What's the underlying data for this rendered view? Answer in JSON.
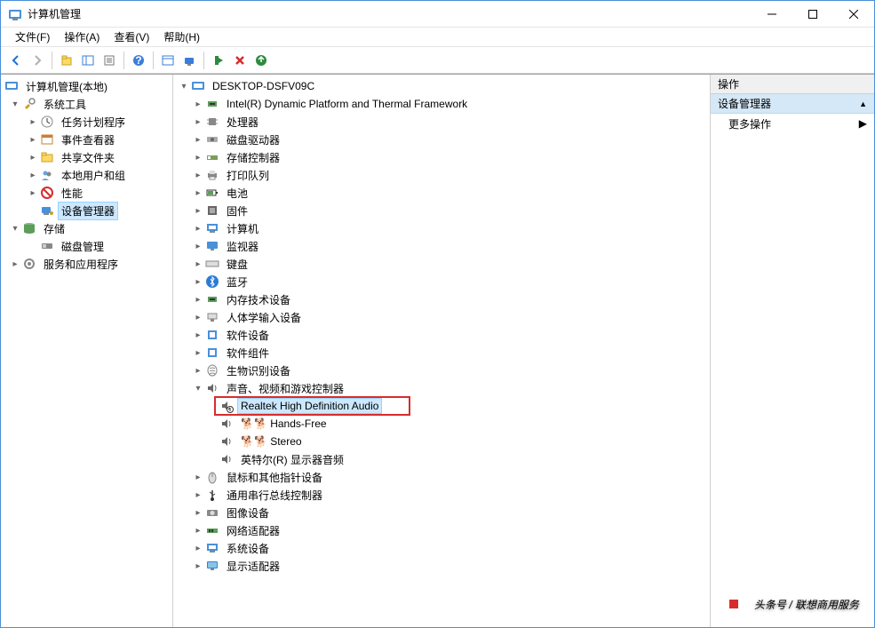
{
  "window": {
    "title": "计算机管理"
  },
  "menu": {
    "file": "文件(F)",
    "action": "操作(A)",
    "view": "查看(V)",
    "help": "帮助(H)"
  },
  "left_tree": {
    "root": "计算机管理(本地)",
    "system_tools": "系统工具",
    "task_scheduler": "任务计划程序",
    "event_viewer": "事件查看器",
    "shared_folders": "共享文件夹",
    "local_users": "本地用户和组",
    "performance": "性能",
    "device_manager": "设备管理器",
    "storage": "存储",
    "disk_mgmt": "磁盘管理",
    "services_apps": "服务和应用程序"
  },
  "mid_tree": {
    "root": "DESKTOP-DSFV09C",
    "intel_dpt": "Intel(R) Dynamic Platform and Thermal Framework",
    "processors": "处理器",
    "disk_drives": "磁盘驱动器",
    "storage_ctrl": "存储控制器",
    "print_queues": "打印队列",
    "batteries": "电池",
    "firmware": "固件",
    "computer": "计算机",
    "monitors": "监视器",
    "keyboards": "键盘",
    "bluetooth": "蓝牙",
    "memory_tech": "内存技术设备",
    "hid": "人体学输入设备",
    "soft_devices": "软件设备",
    "soft_components": "软件组件",
    "biometric": "生物识别设备",
    "sound": "声音、视频和游戏控制器",
    "realtek": "Realtek High Definition Audio",
    "hands_free": "🐕🐕 Hands-Free",
    "stereo": "🐕🐕 Stereo",
    "intel_display_audio": "英特尔(R) 显示器音频",
    "mice": "鼠标和其他指针设备",
    "usb_ctrl": "通用串行总线控制器",
    "imaging": "图像设备",
    "network": "网络适配器",
    "system_dev": "系统设备",
    "display_adapters": "显示适配器"
  },
  "right": {
    "header": "操作",
    "section": "设备管理器",
    "more": "更多操作"
  },
  "watermark": "头条号 / 联想商用服务"
}
